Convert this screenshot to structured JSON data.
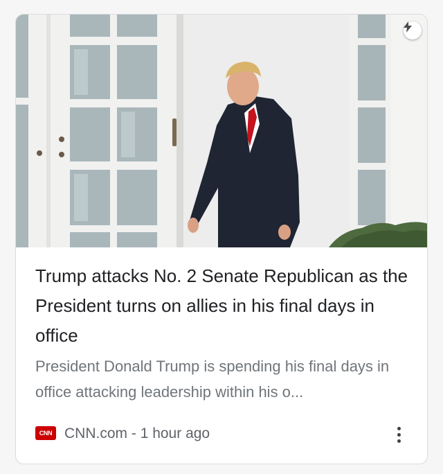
{
  "article": {
    "headline": "Trump attacks No. 2 Senate Republican as the President turns on allies in his final days in office",
    "snippet": "President Donald Trump is spending his final days in office attacking leadership within his o...",
    "source": {
      "logo_text": "CNN",
      "name": "CNN.com",
      "separator": " - ",
      "time": "1 hour ago"
    }
  },
  "icons": {
    "amp": "lightning-bolt-icon",
    "menu": "more-vert-icon"
  },
  "colors": {
    "headline": "#202124",
    "snippet": "#70757a",
    "source_text": "#5f6368",
    "cnn_red": "#cc0000",
    "card_border": "#dcdcdc"
  }
}
